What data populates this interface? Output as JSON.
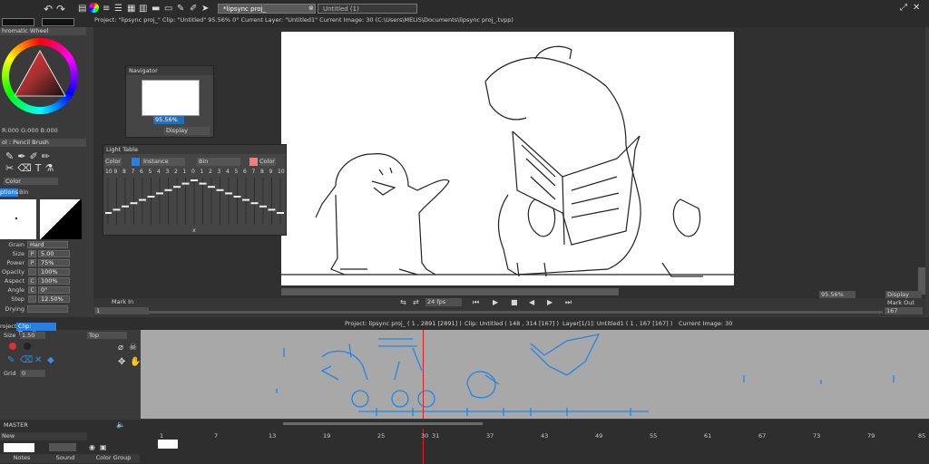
{
  "tabs": [
    {
      "label": "*lipsync proj_"
    },
    {
      "label": "Untitled (1)"
    }
  ],
  "infobar": "Project: \"lipsync proj_\"  Clip: \"Untitled\"  95.56%  0°  Current Layer: \"Untitled1\"  Current Image: 30 (C:\\Users\\MELIS\\Documents\\lipsync proj_.tvpp)",
  "left": {
    "chromatic_title": "hromatic Wheel",
    "rgb": "R:000 G:000 B:000",
    "tool_title": "ol : Pencil Brush",
    "color_label": "Color",
    "tabs": [
      "ptions",
      "Bin"
    ],
    "grain_label": "Grain",
    "grain_value": "Hard",
    "params": [
      {
        "label": "Size",
        "mode": "P",
        "value": "5.00"
      },
      {
        "label": "Power",
        "mode": "P",
        "value": "75%"
      },
      {
        "label": "Opacity",
        "mode": "",
        "value": "100%"
      },
      {
        "label": "Aspect",
        "mode": "C",
        "value": "100%"
      },
      {
        "label": "Angle",
        "mode": "C",
        "value": "0°"
      },
      {
        "label": "Step",
        "mode": "",
        "value": "12.50%"
      }
    ],
    "drying": "Drying"
  },
  "navigator": {
    "title": "Navigator",
    "zoom": "95.56%",
    "display": "Display"
  },
  "lighttable": {
    "title": "Light Table",
    "color_a": "Color",
    "instance": "Instance",
    "bin": "Bin",
    "color_b": "Color",
    "numbers": [
      "10",
      "9",
      "8",
      "7",
      "6",
      "5",
      "4",
      "3",
      "2",
      "1",
      "0",
      "1",
      "2",
      "3",
      "4",
      "5",
      "6",
      "7",
      "8",
      "9",
      "10"
    ],
    "x": "x"
  },
  "transport": {
    "mark_in": "Mark In",
    "fps": "24 fps",
    "in_value": "1",
    "zoom": "95.56%",
    "display": "Display",
    "mark_out": "Mark Out",
    "out_value": "167"
  },
  "tlinfo": {
    "project": "Project: lipsync proj_ ( 1 , 2891  [2891] )",
    "clip": "Clip: Untitled ( 148 , 314  [167] )",
    "layer": "Layer[1/1]: Untitled1 ( 1 , 167  [167] )",
    "image": "Current Image: 30"
  },
  "tlpanel": {
    "project": "roject",
    "clip_tab": "Clip: Timeline",
    "size_label": "Size",
    "size_value": "1.50",
    "pos": "Top",
    "grid_label": "Grid",
    "grid_value": "0"
  },
  "bottom": {
    "master": "MASTER",
    "new": "New",
    "notes": "Notes",
    "sound": "Sound",
    "color_group": "Color Group"
  },
  "ticks": [
    "1",
    "7",
    "13",
    "19",
    "25",
    "30",
    "31",
    "37",
    "43",
    "49",
    "55",
    "61",
    "67",
    "73",
    "79",
    "85"
  ],
  "colors": {
    "accent": "#2a7fe0",
    "sketch": "#1f87e6",
    "playhead": "#e02020",
    "bg": "#3b3b3b"
  }
}
